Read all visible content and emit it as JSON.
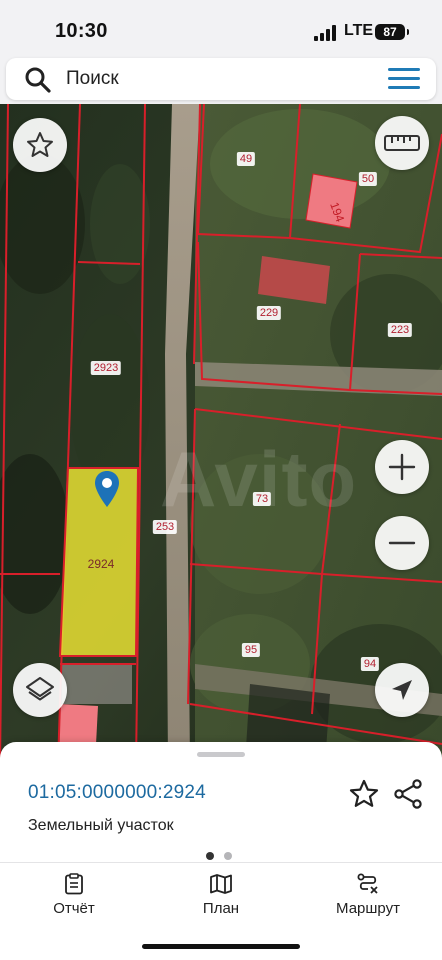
{
  "status_bar": {
    "time": "10:30",
    "network": "LTE",
    "battery": "87"
  },
  "search": {
    "placeholder": "Поиск"
  },
  "map": {
    "parcels": [
      "49",
      "50",
      "229",
      "223",
      "2923",
      "2924",
      "253",
      "73",
      "95",
      "94"
    ],
    "selected_parcel": "2924",
    "watermark": "Avito",
    "colors": {
      "boundary": "#d81f2a",
      "selected_fill": "#e8e033",
      "building": "#ef7a82",
      "road": "#9a8f80"
    }
  },
  "card": {
    "cadastral_number": "01:05:0000000:2924",
    "property_type": "Земельный участок",
    "pages": 2,
    "active_page": 1
  },
  "bottom_nav": {
    "items": [
      {
        "label": "Отчёт",
        "icon": "clipboard-icon"
      },
      {
        "label": "План",
        "icon": "map-icon"
      },
      {
        "label": "Маршрут",
        "icon": "route-icon"
      }
    ]
  }
}
